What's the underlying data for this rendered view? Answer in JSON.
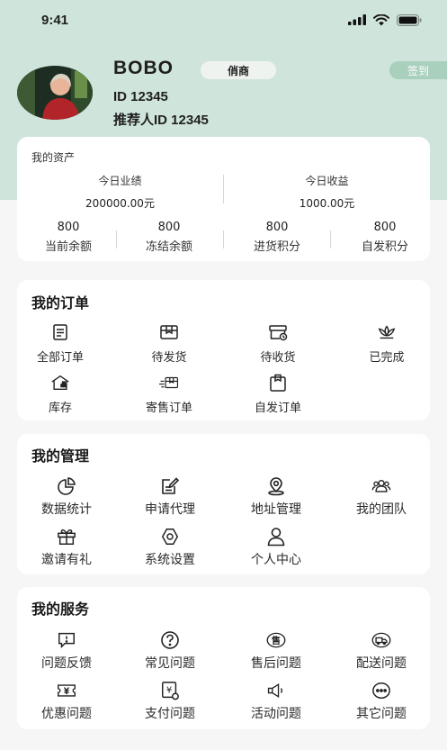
{
  "status_bar": {
    "time": "9:41"
  },
  "profile": {
    "name": "BOBO",
    "role_badge": "俏商",
    "signin_label": "签到",
    "id_line": "ID  12345",
    "referrer_line": "推荐人ID  12345"
  },
  "assets": {
    "title": "我的资产",
    "today_performance": {
      "label": "今日业绩",
      "value": "200000.00元"
    },
    "today_income": {
      "label": "今日收益",
      "value": "1000.00元"
    },
    "balances": [
      {
        "value": "800",
        "label": "当前余额"
      },
      {
        "value": "800",
        "label": "冻结余额"
      },
      {
        "value": "800",
        "label": "进货积分"
      },
      {
        "value": "800",
        "label": "自发积分"
      }
    ]
  },
  "orders": {
    "title": "我的订单",
    "items": [
      {
        "label": "全部订单",
        "icon": "document-icon"
      },
      {
        "label": "待发货",
        "icon": "package-icon"
      },
      {
        "label": "待收货",
        "icon": "delivery-box-icon"
      },
      {
        "label": "已完成",
        "icon": "lotus-icon"
      },
      {
        "label": "库存",
        "icon": "warehouse-icon"
      },
      {
        "label": "寄售订单",
        "icon": "fast-delivery-icon"
      },
      {
        "label": "自发订单",
        "icon": "bag-icon"
      }
    ]
  },
  "management": {
    "title": "我的管理",
    "items": [
      {
        "label": "数据统计",
        "icon": "pie-chart-icon"
      },
      {
        "label": "申请代理",
        "icon": "edit-form-icon"
      },
      {
        "label": "地址管理",
        "icon": "location-icon"
      },
      {
        "label": "我的团队",
        "icon": "team-icon"
      },
      {
        "label": "邀请有礼",
        "icon": "gift-icon"
      },
      {
        "label": "系统设置",
        "icon": "gear-icon"
      },
      {
        "label": "个人中心",
        "icon": "user-icon"
      }
    ]
  },
  "services": {
    "title": "我的服务",
    "items": [
      {
        "label": "问题反馈",
        "icon": "feedback-icon"
      },
      {
        "label": "常见问题",
        "icon": "question-icon"
      },
      {
        "label": "售后问题",
        "icon": "after-sale-icon",
        "glyph": "售"
      },
      {
        "label": "配送问题",
        "icon": "truck-icon"
      },
      {
        "label": "优惠问题",
        "icon": "coupon-icon"
      },
      {
        "label": "支付问题",
        "icon": "payment-icon",
        "glyph": "¥"
      },
      {
        "label": "活动问题",
        "icon": "megaphone-icon"
      },
      {
        "label": "其它问题",
        "icon": "more-icon"
      }
    ]
  }
}
